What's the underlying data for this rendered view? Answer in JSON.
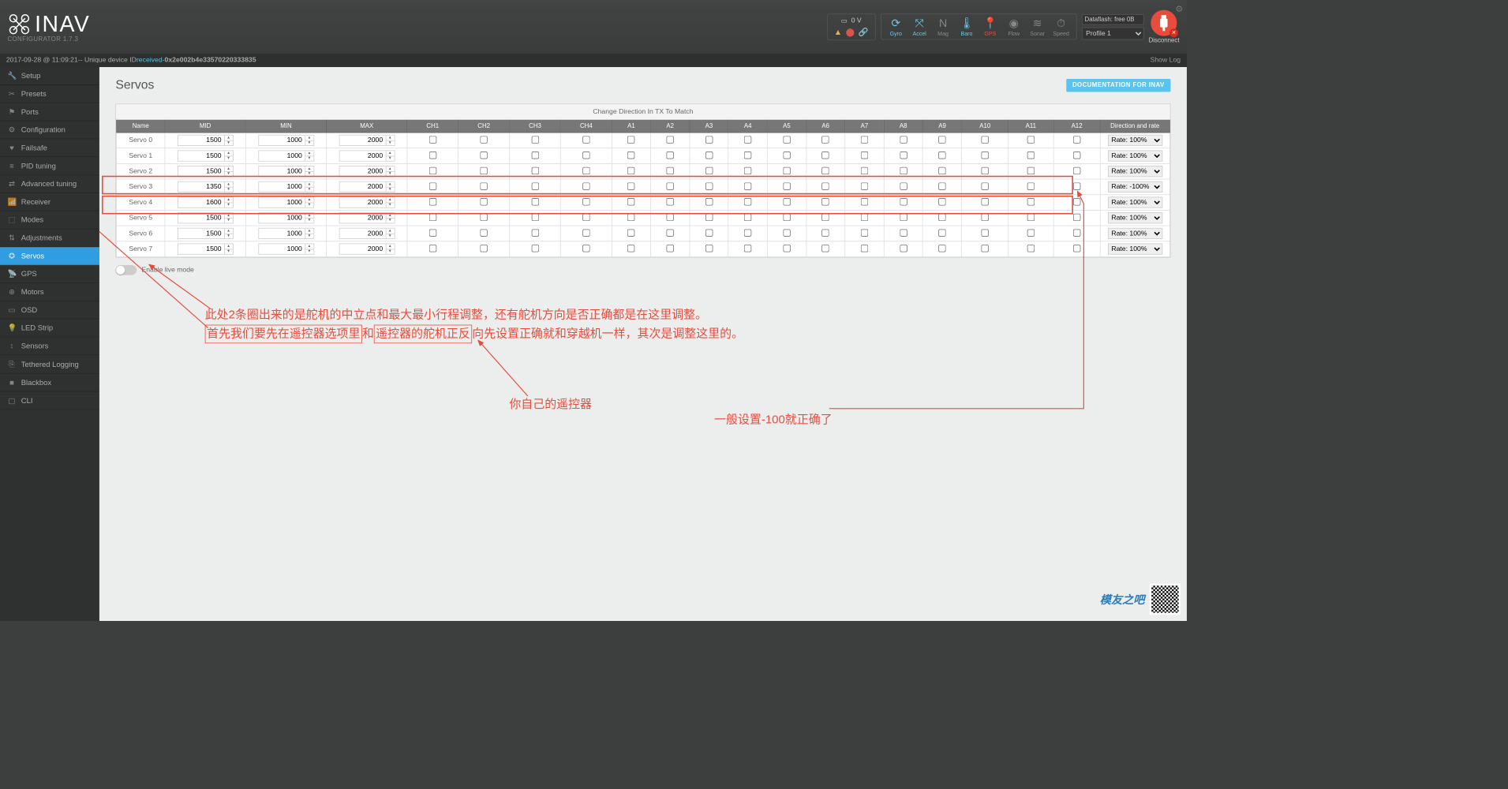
{
  "header": {
    "logo": "INAV",
    "subtitle": "CONFIGURATOR  1.7.3",
    "battery_voltage": "0 V",
    "dataflash": "Dataflash: free 0B",
    "profile": "Profile 1",
    "disconnect": "Disconnect",
    "sensors": [
      {
        "name": "Gyro",
        "active": true
      },
      {
        "name": "Accel",
        "active": true
      },
      {
        "name": "Mag",
        "active": false
      },
      {
        "name": "Baro",
        "active": true
      },
      {
        "name": "GPS",
        "active": false,
        "gps": true
      },
      {
        "name": "Flow",
        "active": false
      },
      {
        "name": "Sonar",
        "active": false
      },
      {
        "name": "Speed",
        "active": false
      }
    ]
  },
  "log": {
    "timestamp": "2017-09-28 @ 11:09:21",
    "sep": " -- Unique device ID ",
    "received": "received",
    "sep2": " - ",
    "device_id": "0x2e002b4e33570220333835",
    "show_log": "Show Log"
  },
  "sidebar": [
    {
      "icon": "🔧",
      "label": "Setup"
    },
    {
      "icon": "✂",
      "label": "Presets"
    },
    {
      "icon": "⚑",
      "label": "Ports"
    },
    {
      "icon": "⚙",
      "label": "Configuration"
    },
    {
      "icon": "♥",
      "label": "Failsafe"
    },
    {
      "icon": "≡",
      "label": "PID tuning"
    },
    {
      "icon": "⇄",
      "label": "Advanced tuning"
    },
    {
      "icon": "📶",
      "label": "Receiver"
    },
    {
      "icon": "⬚",
      "label": "Modes"
    },
    {
      "icon": "⇅",
      "label": "Adjustments"
    },
    {
      "icon": "✪",
      "label": "Servos",
      "active": true
    },
    {
      "icon": "📡",
      "label": "GPS"
    },
    {
      "icon": "⊕",
      "label": "Motors"
    },
    {
      "icon": "▭",
      "label": "OSD"
    },
    {
      "icon": "💡",
      "label": "LED Strip"
    },
    {
      "icon": "↕",
      "label": "Sensors"
    },
    {
      "icon": "⎘",
      "label": "Tethered Logging"
    },
    {
      "icon": "■",
      "label": "Blackbox"
    },
    {
      "icon": "▢",
      "label": "CLI"
    }
  ],
  "page": {
    "title": "Servos",
    "doc_button": "DOCUMENTATION FOR INAV",
    "caption": "Change Direction In TX To Match",
    "columns": [
      "Name",
      "MID",
      "MIN",
      "MAX",
      "CH1",
      "CH2",
      "CH3",
      "CH4",
      "A1",
      "A2",
      "A3",
      "A4",
      "A5",
      "A6",
      "A7",
      "A8",
      "A9",
      "A10",
      "A11",
      "A12",
      "Direction and rate"
    ],
    "rows": [
      {
        "name": "Servo 0",
        "mid": 1500,
        "min": 1000,
        "max": 2000,
        "rate": "Rate: 100%"
      },
      {
        "name": "Servo 1",
        "mid": 1500,
        "min": 1000,
        "max": 2000,
        "rate": "Rate: 100%"
      },
      {
        "name": "Servo 2",
        "mid": 1500,
        "min": 1000,
        "max": 2000,
        "rate": "Rate: 100%"
      },
      {
        "name": "Servo 3",
        "mid": 1350,
        "min": 1000,
        "max": 2000,
        "rate": "Rate: -100%",
        "hl": true
      },
      {
        "name": "Servo 4",
        "mid": 1600,
        "min": 1000,
        "max": 2000,
        "rate": "Rate: 100%",
        "hl": true
      },
      {
        "name": "Servo 5",
        "mid": 1500,
        "min": 1000,
        "max": 2000,
        "rate": "Rate: 100%"
      },
      {
        "name": "Servo 6",
        "mid": 1500,
        "min": 1000,
        "max": 2000,
        "rate": "Rate: 100%"
      },
      {
        "name": "Servo 7",
        "mid": 1500,
        "min": 1000,
        "max": 2000,
        "rate": "Rate: 100%"
      }
    ],
    "live_mode": "Enable live mode"
  },
  "annotations": {
    "line1_a": "此处2条圈出来的是舵机的中立点和最大最小行程调整，还有舵机方向是否正确都是在这里调整。",
    "line2_a": "首先我们要先在遥控器选项里",
    "line2_mid": "和",
    "line2_b": "遥控器的舵机正反",
    "line2_c": "向先设置正确就和穿越机一样，其次是调整这里的。",
    "controller": "你自己的遥控器",
    "rate_note": "一般设置-100就正确了"
  },
  "footer": {
    "brand": "模友之吧"
  }
}
